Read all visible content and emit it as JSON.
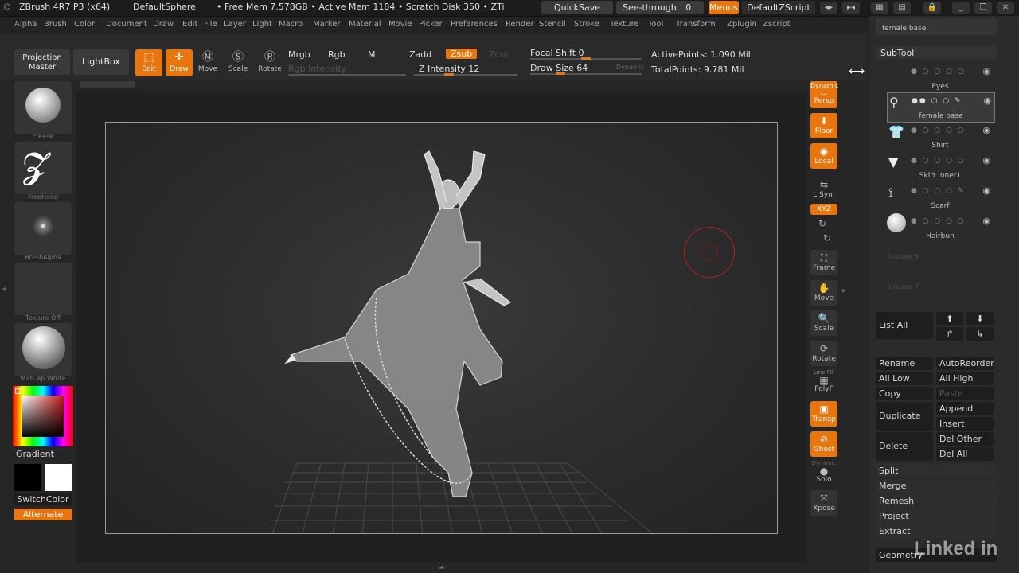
{
  "titlebar": {
    "app": "ZBrush 4R7 P3 (x64)",
    "doc": "DefaultSphere",
    "status": "• Free Mem 7.578GB • Active Mem 1184 • Scratch Disk 350 • ZTi",
    "quicksave": "QuickSave",
    "seethrough": "See-through",
    "seethrough_val": "0",
    "menus": "Menus",
    "script": "DefaultZScript"
  },
  "menubar": [
    "Alpha",
    "Brush",
    "Color",
    "Document",
    "Draw",
    "Edit",
    "File",
    "Layer",
    "Light",
    "Macro",
    "Marker",
    "Material",
    "Movie",
    "Picker",
    "Preferences",
    "Render",
    "Stencil",
    "Stroke",
    "Texture",
    "Tool",
    "Transform",
    "Zplugin",
    "Zscript"
  ],
  "shelf": {
    "projection_master": "Projection Master",
    "lightbox": "LightBox",
    "edit": "Edit",
    "draw": "Draw",
    "move": "Move",
    "scale": "Scale",
    "rotate": "Rotate",
    "mrgb": "Mrgb",
    "rgb": "Rgb",
    "m": "M",
    "zadd": "Zadd",
    "zsub": "Zsub",
    "zcut": "Zcut",
    "rgb_intensity": "Rgb Intensity",
    "z_intensity": "Z Intensity 12",
    "focal_shift": "Focal Shift 0",
    "draw_size": "Draw Size 64",
    "dynamic": "Dynamic",
    "active_points": "ActivePoints: 1.090 Mil",
    "total_points": "TotalPoints: 9.781 Mil"
  },
  "leftshelf": {
    "brush": "crease",
    "stroke": "FreeHand",
    "alpha": "BrushAlpha",
    "texture": "Texture Off",
    "material": "MatCap White",
    "gradient": "Gradient",
    "switchcolor": "SwitchColor",
    "alternate": "Alternate"
  },
  "rightshelf": {
    "dynamic": "Dynamic",
    "persp": "Persp",
    "floor": "Floor",
    "local": "Local",
    "lsym": "L.Sym",
    "xyz": "XYZ",
    "frame": "Frame",
    "move": "Move",
    "scale": "Scale",
    "rotate": "Rotate",
    "linefill": "Line Fill",
    "polyf": "PolyF",
    "transp": "Transp",
    "ghost": "Ghost",
    "dyn2": "Dynamic",
    "solo": "Solo",
    "xpose": "Xpose"
  },
  "tray": {
    "top_name": "female base",
    "subtool_title": "SubTool",
    "items": [
      {
        "name": "Eyes"
      },
      {
        "name": "female base"
      },
      {
        "name": "Shirt"
      },
      {
        "name": "Skirt inner1"
      },
      {
        "name": "Scarf"
      },
      {
        "name": "Hairbun"
      }
    ],
    "unused6": "Unused 6",
    "unused7": "Unused 7",
    "list_all": "List All",
    "rename": "Rename",
    "autoreorder": "AutoReorder",
    "all_low": "All Low",
    "all_high": "All High",
    "copy": "Copy",
    "paste": "Paste",
    "duplicate": "Duplicate",
    "append": "Append",
    "insert": "Insert",
    "delete": "Delete",
    "del_other": "Del Other",
    "del_all": "Del All",
    "split": "Split",
    "merge": "Merge",
    "remesh": "Remesh",
    "project": "Project",
    "extract": "Extract",
    "geometry": "Geometry",
    "watermark": "Linked in"
  },
  "colors": {
    "accent": "#e8750e",
    "bg": "#262626"
  }
}
